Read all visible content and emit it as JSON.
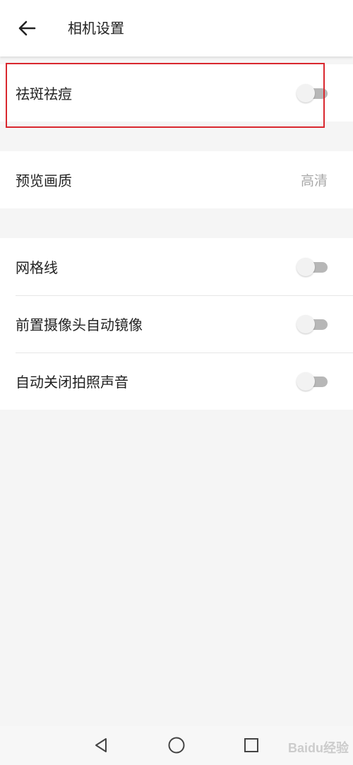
{
  "header": {
    "title": "相机设置",
    "back_icon": "arrow-left-icon"
  },
  "settings": {
    "beauty": {
      "label": "祛斑祛痘",
      "enabled": false
    },
    "preview_quality": {
      "label": "预览画质",
      "value": "高清"
    },
    "grid_lines": {
      "label": "网格线",
      "enabled": false
    },
    "front_mirror": {
      "label": "前置摄像头自动镜像",
      "enabled": false
    },
    "shutter_sound_off": {
      "label": "自动关闭拍照声音",
      "enabled": false
    }
  },
  "navbar": {
    "back": "triangle-back-icon",
    "home": "circle-home-icon",
    "recents": "square-recents-icon"
  },
  "watermark": "Baidu经验",
  "colors": {
    "highlight": "#d9272e",
    "toggle_track_off": "#b7b7b7",
    "secondary_text": "#a8a8a8"
  }
}
